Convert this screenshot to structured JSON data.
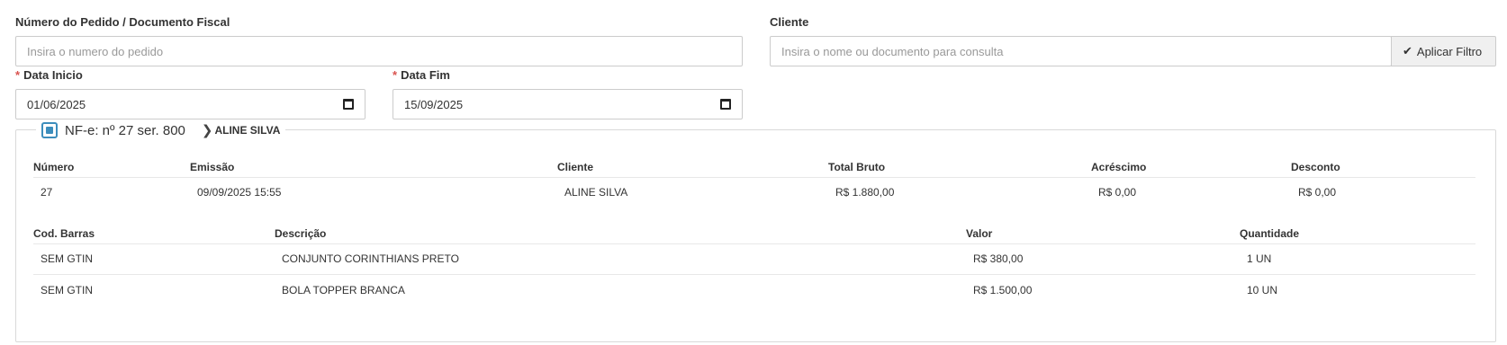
{
  "filters": {
    "order_label": "Número do Pedido / Documento Fiscal",
    "order_placeholder": "Insira o numero do pedido",
    "client_label": "Cliente",
    "client_placeholder": "Insira o nome ou documento para consulta",
    "apply_button": "Aplicar Filtro",
    "start_label": "Data Inicio",
    "start_value": "01/06/2025",
    "end_label": "Data Fim",
    "end_value": "15/09/2025",
    "required_mark": "*"
  },
  "nfe": {
    "title": "NF-e: nº 27 ser. 800",
    "client": "ALINE SILVA",
    "summary_headers": [
      "Número",
      "Emissão",
      "Cliente",
      "Total Bruto",
      "Acréscimo",
      "Desconto"
    ],
    "summary_row": [
      "27",
      "09/09/2025 15:55",
      "ALINE SILVA",
      "R$ 1.880,00",
      "R$ 0,00",
      "R$ 0,00"
    ],
    "items_headers": [
      "Cod. Barras",
      "Descrição",
      "Valor",
      "Quantidade"
    ],
    "items": [
      [
        "SEM GTIN",
        "CONJUNTO CORINTHIANS PRETO",
        "R$ 380,00",
        "1 UN"
      ],
      [
        "SEM GTIN",
        "BOLA TOPPER BRANCA",
        "R$ 1.500,00",
        "10 UN"
      ]
    ]
  },
  "icons": {
    "apply": "check-icon",
    "date": "calendar-icon",
    "select": "checkbox-icon",
    "expand": "chevron-right-icon"
  },
  "colors": {
    "accent": "#3c8dbc",
    "required": "#d9534f"
  }
}
